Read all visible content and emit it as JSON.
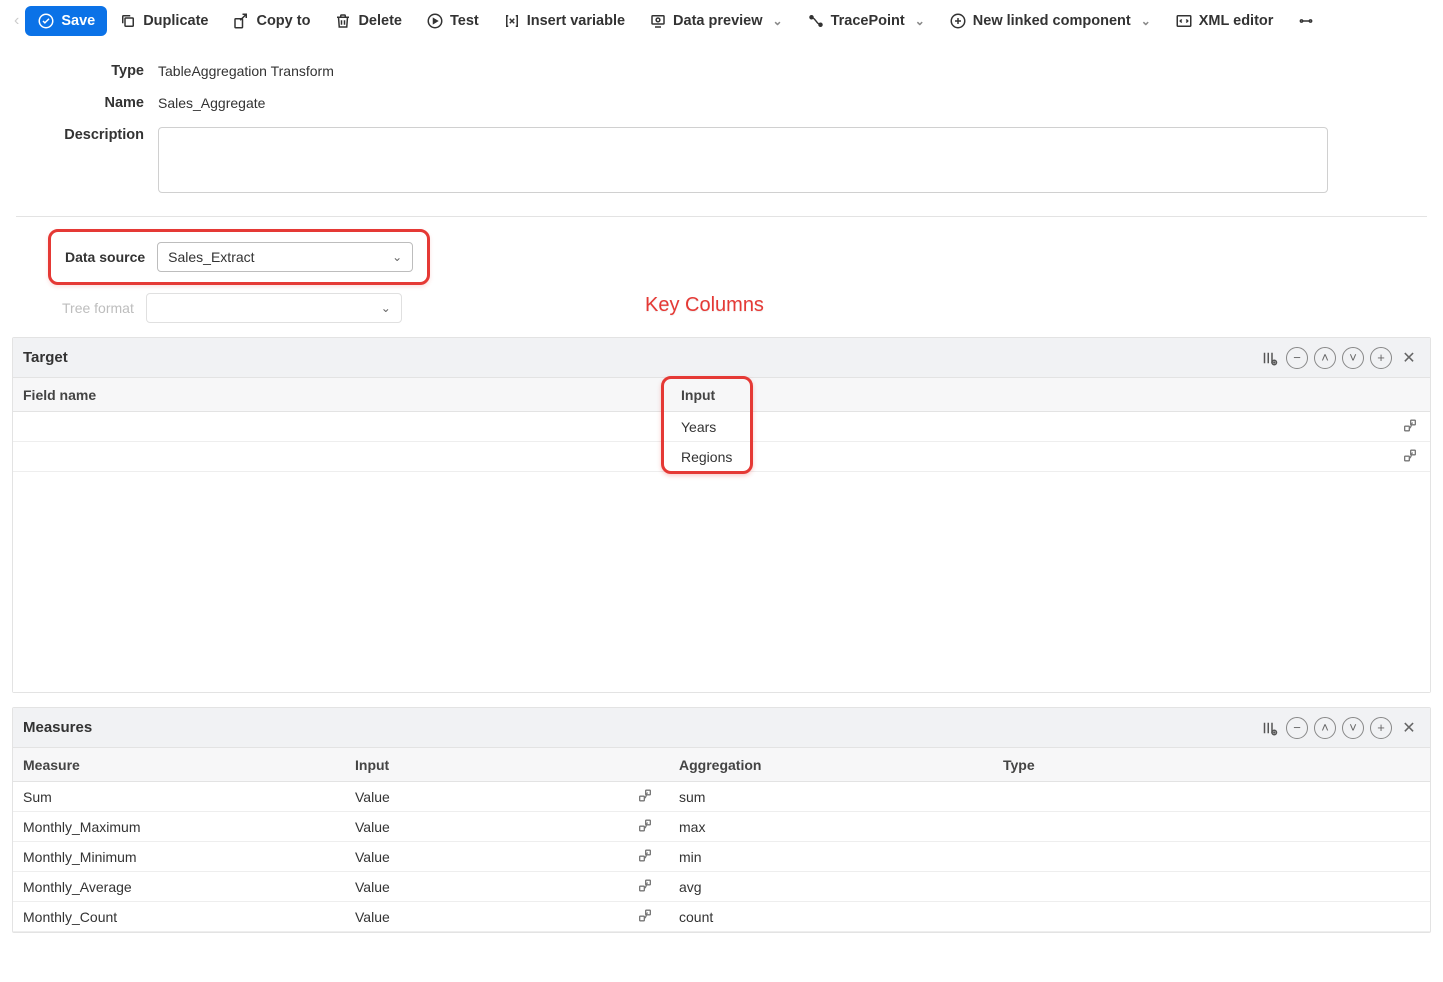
{
  "toolbar": {
    "save": "Save",
    "duplicate": "Duplicate",
    "copy_to": "Copy to",
    "delete": "Delete",
    "test": "Test",
    "insert_variable": "Insert variable",
    "data_preview": "Data preview",
    "tracepoint": "TracePoint",
    "new_linked": "New linked component",
    "xml_editor": "XML editor"
  },
  "form": {
    "type_label": "Type",
    "type_value": "TableAggregation Transform",
    "name_label": "Name",
    "name_value": "Sales_Aggregate",
    "description_label": "Description",
    "description_value": ""
  },
  "datasource": {
    "label": "Data source",
    "value": "Sales_Extract",
    "tree_format_label": "Tree format",
    "tree_format_value": ""
  },
  "annotation": {
    "key_columns": "Key Columns"
  },
  "target": {
    "title": "Target",
    "field_header": "Field name",
    "input_header": "Input",
    "rows": [
      {
        "field": "",
        "input": "Years"
      },
      {
        "field": "",
        "input": "Regions"
      }
    ]
  },
  "measures": {
    "title": "Measures",
    "headers": {
      "measure": "Measure",
      "input": "Input",
      "aggregation": "Aggregation",
      "type": "Type"
    },
    "rows": [
      {
        "measure": "Sum",
        "input": "Value",
        "aggregation": "sum",
        "type": ""
      },
      {
        "measure": "Monthly_Maximum",
        "input": "Value",
        "aggregation": "max",
        "type": ""
      },
      {
        "measure": "Monthly_Minimum",
        "input": "Value",
        "aggregation": "min",
        "type": ""
      },
      {
        "measure": "Monthly_Average",
        "input": "Value",
        "aggregation": "avg",
        "type": ""
      },
      {
        "measure": "Monthly_Count",
        "input": "Value",
        "aggregation": "count",
        "type": ""
      }
    ]
  }
}
